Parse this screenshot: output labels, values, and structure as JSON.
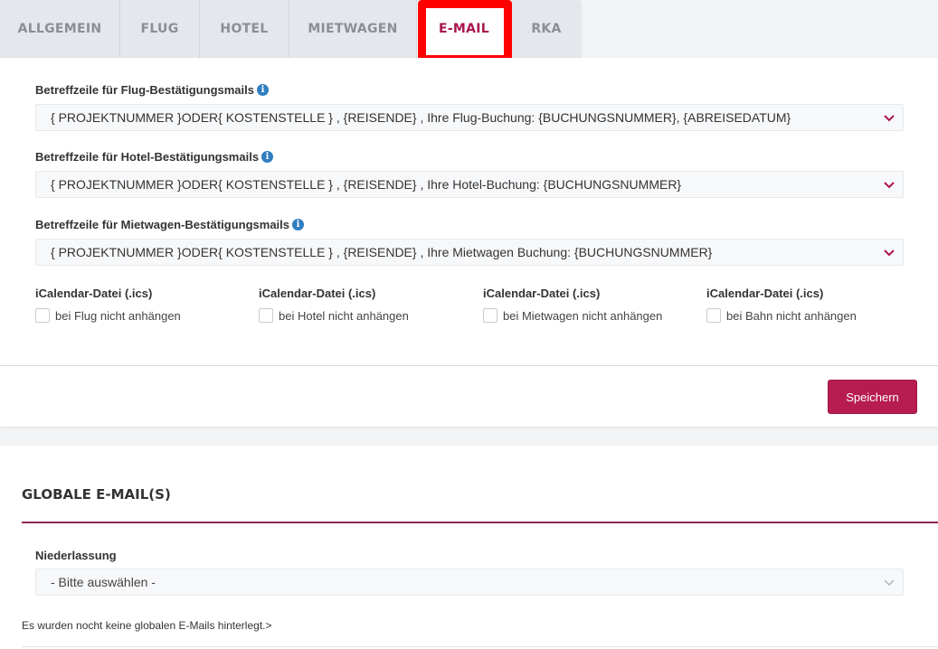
{
  "tabs": [
    {
      "label": "ALLGEMEIN"
    },
    {
      "label": "FLUG"
    },
    {
      "label": "HOTEL"
    },
    {
      "label": "MIETWAGEN"
    },
    {
      "label": "E-MAIL",
      "active": true
    },
    {
      "label": "RKA"
    }
  ],
  "email_settings": {
    "flight_subject": {
      "label": "Betreffzeile für Flug-Bestätigungsmails",
      "value": "{ PROJEKTNUMMER }ODER{ KOSTENSTELLE } , {REISENDE} , Ihre Flug-Buchung: {BUCHUNGSNUMMER}, {ABREISEDATUM}"
    },
    "hotel_subject": {
      "label": "Betreffzeile für Hotel-Bestätigungsmails",
      "value": "{ PROJEKTNUMMER }ODER{ KOSTENSTELLE } , {REISENDE} , Ihre Hotel-Buchung: {BUCHUNGSNUMMER}"
    },
    "car_subject": {
      "label": "Betreffzeile für Mietwagen-Bestätigungsmails",
      "value": "{ PROJEKTNUMMER }ODER{ KOSTENSTELLE } , {REISENDE} , Ihre Mietwagen Buchung: {BUCHUNGSNUMMER}"
    },
    "ics": [
      {
        "title": "iCalendar-Datei (.ics)",
        "option": "bei Flug nicht anhängen",
        "checked": false
      },
      {
        "title": "iCalendar-Datei (.ics)",
        "option": "bei Hotel nicht anhängen",
        "checked": false
      },
      {
        "title": "iCalendar-Datei (.ics)",
        "option": "bei Mietwagen nicht anhängen",
        "checked": false
      },
      {
        "title": "iCalendar-Datei (.ics)",
        "option": "bei Bahn nicht anhängen",
        "checked": false
      }
    ],
    "save_label": "Speichern"
  },
  "global": {
    "title": "GLOBALE E-MAIL(S)",
    "branch_label": "Niederlassung",
    "branch_value": "- Bitte auswählen -",
    "empty_text": "Es wurden nocht keine globalen E-Mails hinterlegt.>"
  },
  "colors": {
    "accent": "#b71c51",
    "highlight": "#ff0000",
    "info": "#2f7ec0"
  }
}
